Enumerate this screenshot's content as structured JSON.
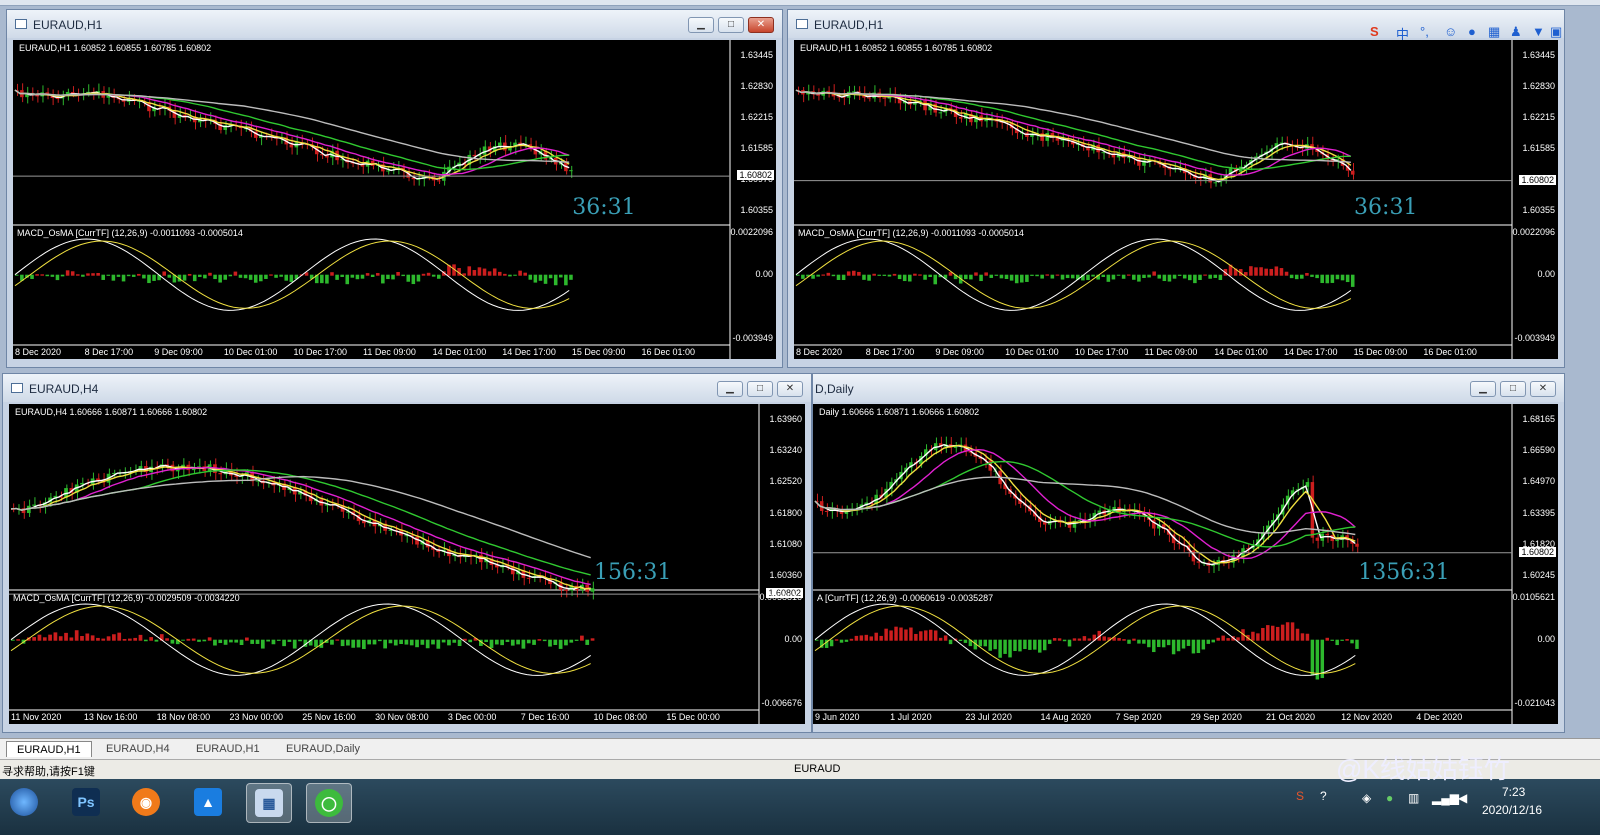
{
  "windows": [
    {
      "id": "w1",
      "title": "EURAUD,H1",
      "info": "EURAUD,H1  1.60852 1.60855 1.60785 1.60802",
      "y_ticks": [
        "1.63445",
        "1.62830",
        "1.62215",
        "1.61585",
        "1.60970",
        "1.60355"
      ],
      "price_label": "1.60802",
      "countdown": "36:31",
      "macd_info": "MACD_OsMA [CurrTF] (12,26,9) -0.0011093 -0.0005014",
      "macd_ticks": [
        "0.0022096",
        "0.00",
        "-0.003949"
      ],
      "x_ticks": [
        "8 Dec 2020",
        "8 Dec 17:00",
        "9 Dec 09:00",
        "10 Dec 01:00",
        "10 Dec 17:00",
        "11 Dec 09:00",
        "14 Dec 01:00",
        "14 Dec 17:00",
        "15 Dec 09:00",
        "16 Dec 01:00"
      ],
      "buttons": [
        "minimize",
        "maximize",
        "close"
      ]
    },
    {
      "id": "w2",
      "title": "EURAUD,H1",
      "info": "EURAUD,H1  1.60852 1.60855 1.60785 1.60802",
      "y_ticks": [
        "1.63445",
        "1.62830",
        "1.62215",
        "1.61585",
        "1.60970",
        "1.60355"
      ],
      "price_label": "1.60802",
      "countdown": "36:31",
      "macd_info": "MACD_OsMA [CurrTF] (12,26,9) -0.0011093 -0.0005014",
      "macd_ticks": [
        "0.0022096",
        "0.00",
        "-0.003949"
      ],
      "x_ticks": [
        "8 Dec 2020",
        "8 Dec 17:00",
        "9 Dec 09:00",
        "10 Dec 01:00",
        "10 Dec 17:00",
        "11 Dec 09:00",
        "14 Dec 01:00",
        "14 Dec 17:00",
        "15 Dec 09:00",
        "16 Dec 01:00"
      ],
      "buttons": []
    },
    {
      "id": "w3",
      "title": "EURAUD,H4",
      "info": "EURAUD,H4  1.60666 1.60871 1.60666 1.60802",
      "y_ticks": [
        "1.63960",
        "1.63240",
        "1.62520",
        "1.61800",
        "1.61080",
        "1.60360"
      ],
      "price_label": "1.60802",
      "countdown": "156:31",
      "macd_info": "MACD_OsMA [CurrTF] (12,26,9) -0.0029509 -0.0034220",
      "macd_ticks": [
        "0.0058816",
        "0.00",
        "-0.006676"
      ],
      "x_ticks": [
        "11 Nov 2020",
        "13 Nov 16:00",
        "18 Nov 08:00",
        "23 Nov 00:00",
        "25 Nov 16:00",
        "30 Nov 08:00",
        "3 Dec 00:00",
        "7 Dec 16:00",
        "10 Dec 08:00",
        "15 Dec 00:00"
      ],
      "buttons": [
        "minimize",
        "maximize",
        "close"
      ]
    },
    {
      "id": "w4",
      "title": "D,Daily",
      "info": "Daily  1.60666 1.60871 1.60666 1.60802",
      "y_ticks": [
        "1.68165",
        "1.66590",
        "1.64970",
        "1.63395",
        "1.61820",
        "1.60245"
      ],
      "price_label": "1.60802",
      "countdown": "1356:31",
      "macd_info": "A [CurrTF] (12,26,9) -0.0060619 -0.0035287",
      "macd_ticks": [
        "0.0105621",
        "0.00",
        "-0.021043"
      ],
      "x_ticks": [
        "9 Jun 2020",
        "1 Jul 2020",
        "23 Jul 2020",
        "14 Aug 2020",
        "7 Sep 2020",
        "29 Sep 2020",
        "21 Oct 2020",
        "12 Nov 2020",
        "4 Dec 2020"
      ],
      "buttons": [
        "minimize",
        "maximize",
        "close"
      ]
    }
  ],
  "tabs": [
    "EURAUD,H1",
    "EURAUD,H4",
    "EURAUD,H1",
    "EURAUD,Daily"
  ],
  "status": {
    "help": "寻求帮助,请按F1键",
    "symbol": "EURAUD"
  },
  "watermark": "@K线姑姑钰竹",
  "taskbar": {
    "items": [
      {
        "name": "start-button",
        "glyph": ""
      },
      {
        "name": "photoshop",
        "glyph": "Ps"
      },
      {
        "name": "app-orange",
        "glyph": "◉"
      },
      {
        "name": "app-blue",
        "glyph": "▲"
      },
      {
        "name": "metatrader",
        "glyph": "▦"
      },
      {
        "name": "wechat",
        "glyph": "◯"
      }
    ],
    "time": "7:23",
    "date": "2020/12/16"
  },
  "ime": {
    "lang": "中"
  },
  "colors": {
    "bull": "#2db82d",
    "bear": "#cc1e1e",
    "ma_fast": "#ffffff",
    "ma_yellow": "#f0e040",
    "ma_magenta": "#e020d0",
    "ma_green": "#30c830",
    "ma_gray": "#bcbcbc",
    "countdown": "#3a9fb6"
  }
}
